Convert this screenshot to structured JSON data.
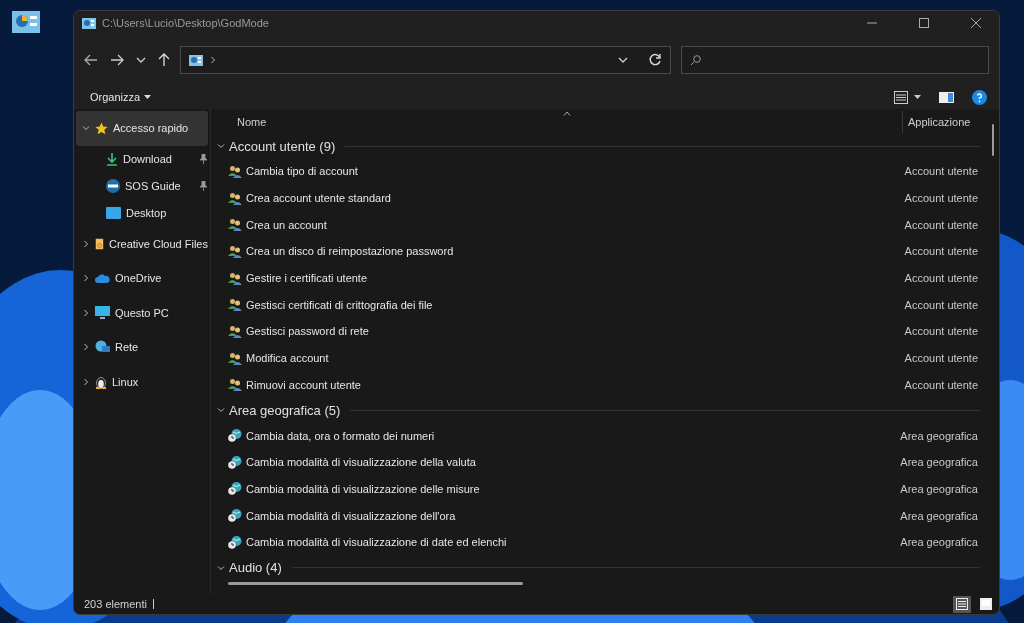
{
  "window": {
    "title": "C:\\Users\\Lucio\\Desktop\\GodMode"
  },
  "toolbar": {
    "organize": "Organizza"
  },
  "sidebar": {
    "items": [
      {
        "label": "Accesso rapido",
        "expanded": true,
        "selected": true,
        "children": [
          {
            "label": "Download",
            "pinned": true
          },
          {
            "label": "SOS Guide",
            "pinned": true
          },
          {
            "label": "Desktop",
            "pinned": false
          }
        ]
      },
      {
        "label": "Creative Cloud Files",
        "expanded": false,
        "selected": false
      },
      {
        "label": "OneDrive",
        "expanded": false,
        "selected": false
      },
      {
        "label": "Questo PC",
        "expanded": false,
        "selected": false
      },
      {
        "label": "Rete",
        "expanded": false,
        "selected": false
      },
      {
        "label": "Linux",
        "expanded": false,
        "selected": false
      }
    ]
  },
  "table": {
    "columns": [
      "Nome",
      "Applicazione"
    ],
    "groups": [
      {
        "label": "Account utente (9)",
        "expanded": true,
        "rows": [
          {
            "name": "Cambia tipo di account",
            "app": "Account utente"
          },
          {
            "name": "Crea account utente standard",
            "app": "Account utente"
          },
          {
            "name": "Crea un account",
            "app": "Account utente"
          },
          {
            "name": "Crea un disco di reimpostazione password",
            "app": "Account utente"
          },
          {
            "name": "Gestire i certificati utente",
            "app": "Account utente"
          },
          {
            "name": "Gestisci certificati di crittografia dei file",
            "app": "Account utente"
          },
          {
            "name": "Gestisci password di rete",
            "app": "Account utente"
          },
          {
            "name": "Modifica account",
            "app": "Account utente"
          },
          {
            "name": "Rimuovi account utente",
            "app": "Account utente"
          }
        ]
      },
      {
        "label": "Area geografica (5)",
        "expanded": true,
        "rows": [
          {
            "name": "Cambia data, ora o formato dei numeri",
            "app": "Area geografica"
          },
          {
            "name": "Cambia modalità di visualizzazione della valuta",
            "app": "Area geografica"
          },
          {
            "name": "Cambia modalità di visualizzazione delle misure",
            "app": "Area geografica"
          },
          {
            "name": "Cambia modalità di visualizzazione dell'ora",
            "app": "Area geografica"
          },
          {
            "name": "Cambia modalità di visualizzazione di date ed elenchi",
            "app": "Area geografica"
          }
        ]
      },
      {
        "label": "Audio (4)",
        "expanded": true
      }
    ]
  },
  "status_bar": {
    "count": "203 elementi",
    "views": [
      {
        "selected": true
      },
      {
        "selected": false
      }
    ]
  }
}
